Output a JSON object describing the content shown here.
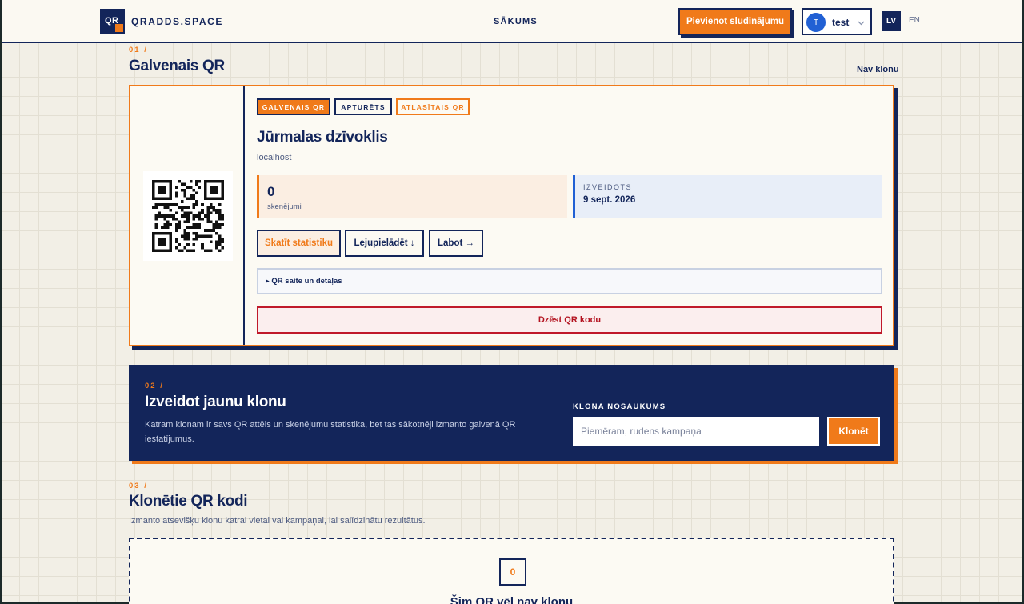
{
  "header": {
    "logo_text": "QR",
    "brand": "QRADDS.SPACE",
    "nav_home": "SĀKUMS",
    "add_listing": "Pievienot sludinājumu",
    "user_initial": "T",
    "user_name": "test",
    "lang_active": "LV",
    "lang_other": "EN",
    "chevron_icon": "chevron-down-icon"
  },
  "section1": {
    "number": "01 /",
    "title": "Galvenais QR",
    "clone_status": "Nav klonu"
  },
  "qr_card": {
    "tags": [
      "GALVENAIS QR",
      "APTURĒTS",
      "ATLASĪTAIS QR"
    ],
    "title": "Jūrmalas dzīvoklis",
    "host": "localhost",
    "scans_value": "0",
    "scans_label": "skenējumi",
    "created_label": "IZVEIDOTS",
    "created_value": "9 sept. 2026",
    "btn_stats": "Skatīt statistiku",
    "btn_download": "Lejupielādēt ↓",
    "btn_edit": "Labot →",
    "details_summary": "▸ QR saite un detaļas",
    "btn_delete": "Dzēst QR kodu"
  },
  "clone_form": {
    "number": "02 /",
    "title": "Izveidot jaunu klonu",
    "description": "Katram klonam ir savs QR attēls un skenējumu statistika, bet tas sākotnēji izmanto galvenā QR iestatījumus.",
    "field_label": "KLONA NOSAUKUMS",
    "placeholder": "Piemēram, rudens kampaņa",
    "btn_clone": "Klonēt"
  },
  "section3": {
    "number": "03 /",
    "title": "Klonētie QR kodi",
    "description": "Izmanto atsevišķu klonu katrai vietai vai kampaņai, lai salīdzinātu rezultātus.",
    "empty_count": "0",
    "empty_text": "Šim QR vēl nav klonu"
  },
  "colors": {
    "navy": "#13255a",
    "orange": "#f07a1a",
    "background": "#f2efe6",
    "danger": "#b3121f"
  }
}
